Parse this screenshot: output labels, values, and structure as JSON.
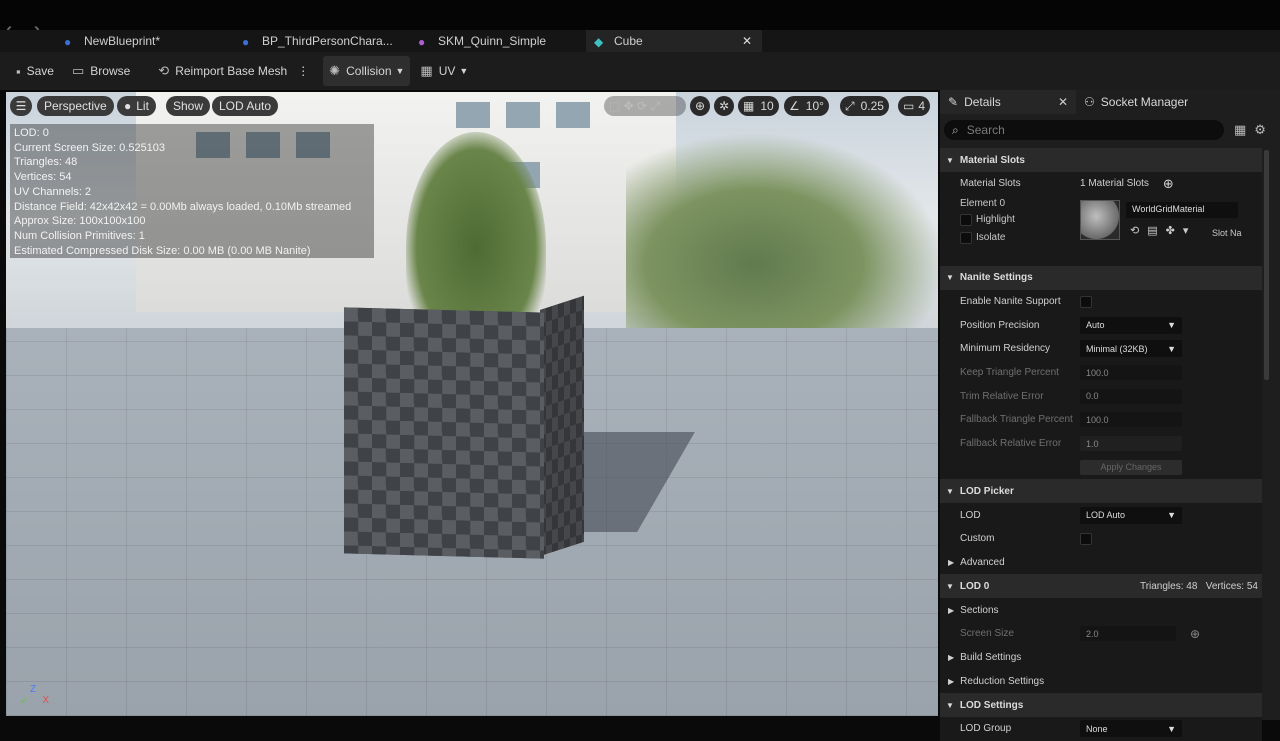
{
  "tabs": [
    {
      "label": "NewBlueprint*",
      "icon": "blueprint-icon",
      "color": "#3c6fd6"
    },
    {
      "label": "BP_ThirdPersonChara...",
      "icon": "character-icon",
      "color": "#3c6fd6"
    },
    {
      "label": "SKM_Quinn_Simple",
      "icon": "skeletal-mesh-icon",
      "color": "#b05fd0"
    },
    {
      "label": "Cube",
      "icon": "static-mesh-icon",
      "color": "#3fbfbf",
      "active": true
    }
  ],
  "toolbar": {
    "save": "Save",
    "browse": "Browse",
    "reimport": "Reimport Base Mesh",
    "collision": "Collision",
    "uv": "UV"
  },
  "viewport": {
    "menu_icon": "hamburger-icon",
    "perspective": "Perspective",
    "lit": "Lit",
    "show": "Show",
    "lod": "LOD Auto",
    "grid_value": "10",
    "angle_value": "10°",
    "scale_value": "0.25",
    "camera_speed": "4",
    "stats": [
      "LOD:  0",
      "Current Screen Size:  0.525103",
      "Triangles:  48",
      "Vertices:  54",
      "UV Channels:  2",
      "Distance Field:  42x42x42 = 0.00Mb always loaded, 0.10Mb streamed",
      "Approx Size: 100x100x100",
      "Num Collision Primitives:  1",
      "Estimated Compressed Disk Size: 0.00 MB (0.00 MB Nanite)"
    ],
    "axis_z": "Z",
    "axis_x": "X"
  },
  "details": {
    "tab_details": "Details",
    "tab_socket": "Socket Manager",
    "search_placeholder": "Search",
    "material_slots": {
      "header": "Material Slots",
      "label": "Material Slots",
      "value": "1 Material Slots",
      "element": "Element 0",
      "highlight": "Highlight",
      "isolate": "Isolate",
      "material_name": "WorldGridMaterial",
      "slot_name": "Slot Na"
    },
    "nanite": {
      "header": "Nanite Settings",
      "enable": "Enable Nanite Support",
      "position_precision": "Position Precision",
      "position_precision_value": "Auto",
      "min_residency": "Minimum Residency",
      "min_residency_value": "Minimal (32KB)",
      "keep_triangle": "Keep Triangle Percent",
      "keep_triangle_value": "100.0",
      "trim_error": "Trim Relative Error",
      "trim_error_value": "0.0",
      "fallback_triangle": "Fallback Triangle Percent",
      "fallback_triangle_value": "100.0",
      "fallback_error": "Fallback Relative Error",
      "fallback_error_value": "1.0",
      "apply": "Apply Changes"
    },
    "lod_picker": {
      "header": "LOD Picker",
      "lod": "LOD",
      "lod_value": "LOD Auto",
      "custom": "Custom",
      "advanced": "Advanced"
    },
    "lod0": {
      "header": "LOD 0",
      "triangles": "Triangles: 48",
      "vertices": "Vertices: 54",
      "sections": "Sections",
      "screen_size": "Screen Size",
      "screen_size_value": "2.0",
      "build": "Build Settings",
      "reduction": "Reduction Settings"
    },
    "lod_settings": {
      "header": "LOD Settings",
      "lod_group": "LOD Group",
      "lod_group_value": "None"
    }
  }
}
